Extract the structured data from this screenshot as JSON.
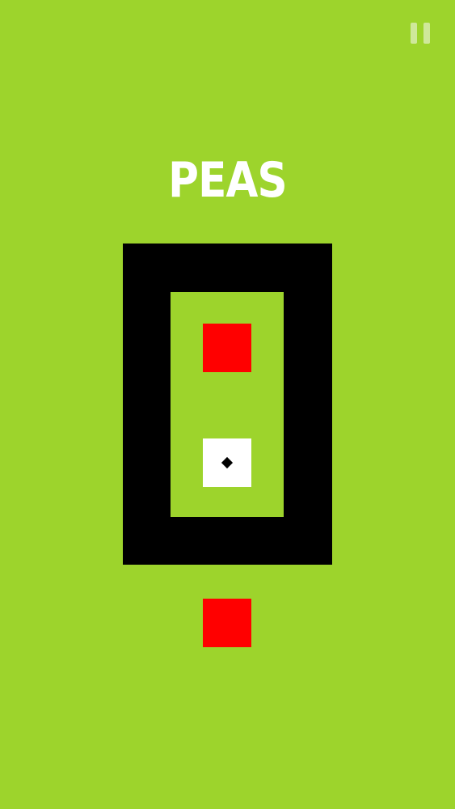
{
  "game": {
    "level_title": "PEAS",
    "colors": {
      "background": "#9dd42c",
      "wall": "#000000",
      "obstacle": "#ff0000",
      "player": "#ffffff",
      "pause": "#cfe89a"
    },
    "icons": {
      "pause": "pause-icon",
      "player_marker": "diamond-icon"
    }
  }
}
